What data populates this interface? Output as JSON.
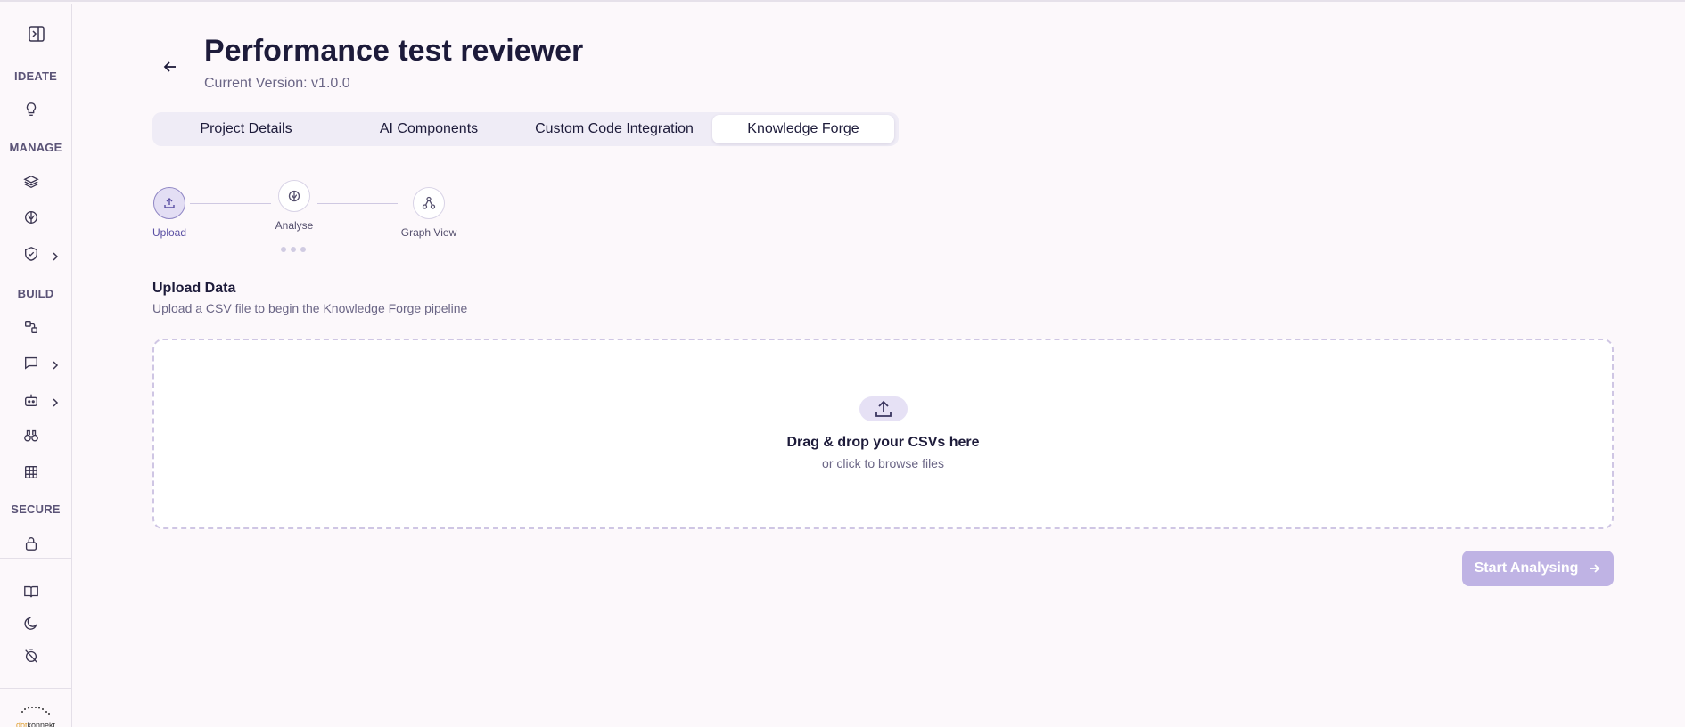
{
  "header": {
    "title": "Performance test reviewer",
    "version": "Current Version: v1.0.0"
  },
  "tabs": [
    {
      "label": "Project Details"
    },
    {
      "label": "AI Components"
    },
    {
      "label": "Custom Code Integration"
    },
    {
      "label": "Knowledge Forge",
      "active": true
    }
  ],
  "sidebar": {
    "sections": {
      "ideate": "IDEATE",
      "manage": "MANAGE",
      "build": "BUILD",
      "secure": "SECURE"
    },
    "logo_text_a": "dot",
    "logo_text_b": "konnekt"
  },
  "stepper": {
    "steps": [
      {
        "label": "Upload",
        "icon": "upload-icon",
        "active": true
      },
      {
        "label": "Analyse",
        "icon": "brain-icon"
      },
      {
        "label": "Graph View",
        "icon": "graph-icon"
      }
    ]
  },
  "upload": {
    "title": "Upload Data",
    "subtitle": "Upload a CSV file to begin the Knowledge Forge pipeline",
    "drop_title": "Drag & drop your CSVs here",
    "drop_sub": "or click to browse files"
  },
  "actions": {
    "start_label": "Start Analysing"
  },
  "colors": {
    "accent": "#5a4fa3",
    "button_disabled": "#bfb3e4",
    "background": "#fcf8fb"
  }
}
